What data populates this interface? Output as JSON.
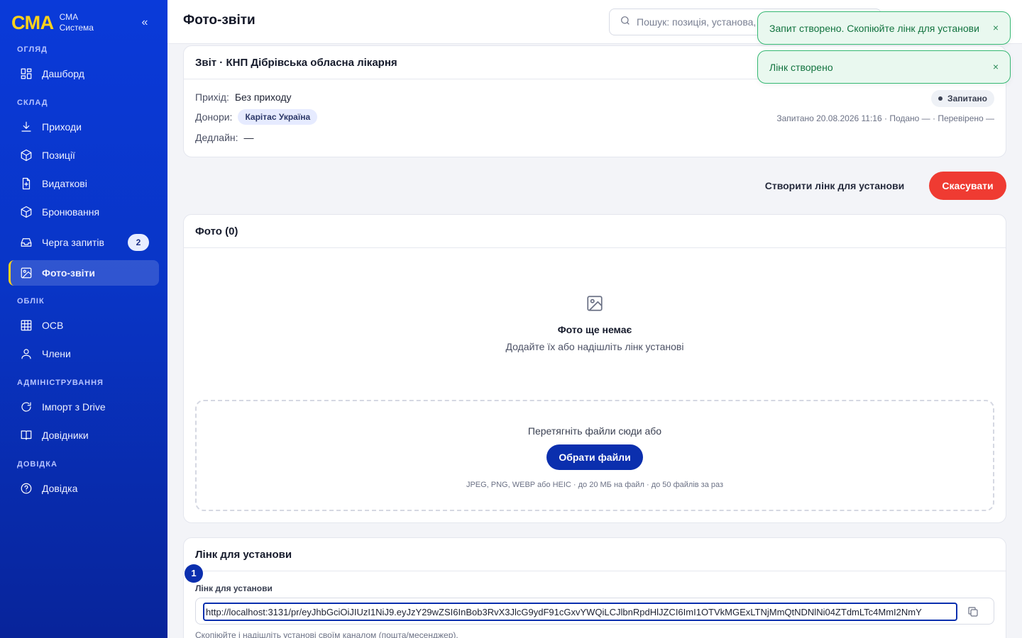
{
  "brand": {
    "logo": "СМА",
    "line1": "СМА",
    "line2": "Система",
    "collapse": "«"
  },
  "sidebar": {
    "sections": [
      {
        "title": "Огляд"
      },
      {
        "title": "Склад"
      },
      {
        "title": "Облік"
      },
      {
        "title": "Адміністрування"
      },
      {
        "title": "Довідка"
      }
    ],
    "items": [
      {
        "label": "Дашборд",
        "icon": "dashboard-icon"
      },
      {
        "label": "Приходи",
        "icon": "download-icon"
      },
      {
        "label": "Позиції",
        "icon": "box-icon"
      },
      {
        "label": "Видаткові",
        "icon": "document-icon"
      },
      {
        "label": "Бронювання",
        "icon": "box-icon"
      },
      {
        "label": "Черга запитів",
        "icon": "inbox-icon",
        "badge": "2"
      },
      {
        "label": "Фото-звіти",
        "icon": "image-icon",
        "active": true
      },
      {
        "label": "ОСВ",
        "icon": "table-icon"
      },
      {
        "label": "Члени",
        "icon": "user-icon"
      },
      {
        "label": "Імпорт з Drive",
        "icon": "refresh-icon"
      },
      {
        "label": "Довідники",
        "icon": "book-icon"
      },
      {
        "label": "Довідка",
        "icon": "help-icon"
      }
    ]
  },
  "header": {
    "title": "Фото-звіти",
    "search_placeholder": "Пошук: позиція, установа, донор…"
  },
  "report": {
    "title": "Звіт · КНП Дібрівська обласна лікарня",
    "income_label": "Прихід:",
    "income_value": "Без приходу",
    "donors_label": "Донори:",
    "donor_chip": "Карітас Україна",
    "deadline_label": "Дедлайн:",
    "deadline_value": "—",
    "status": "Запитано",
    "times": "Запитано 20.08.2026 11:16 · Подано — · Перевірено —"
  },
  "actions": {
    "create_link": "Створити лінк для установи",
    "cancel": "Скасувати"
  },
  "photos": {
    "title": "Фото (0)",
    "empty_title": "Фото ще немає",
    "empty_sub": "Додайте їх або надішліть лінк установі",
    "drop_text": "Перетягніть файли сюди або",
    "choose_button": "Обрати файли",
    "hint": "JPEG, PNG, WEBP або HEIC · до 20 МБ на файл · до 50 файлів за раз"
  },
  "link_section": {
    "title": "Лінк для установи",
    "step": "1",
    "field_label": "Лінк для установи",
    "url": "http://localhost:3131/pr/eyJhbGciOiJIUzI1NiJ9.eyJzY29wZSI6InBob3RvX3JlcG9ydF91cGxvYWQiLCJlbnRpdHlJZCI6ImI1OTVkMGExLTNjMmQtNDNlNi04ZTdmLTc4MmI2NmY",
    "hint": "Скопіюйте і надішліть установі своїм каналом (пошта/месенджер)."
  },
  "toasts": [
    {
      "text": "Запит створено. Скопіюйте лінк для установи",
      "close": "×"
    },
    {
      "text": "Лінк створено",
      "close": "×"
    }
  ],
  "colors": {
    "sidebar": "#0a3ad9",
    "accent": "#ffd21a",
    "primary": "#0b2fae",
    "danger": "#ef3b32",
    "success": "#35b873"
  }
}
